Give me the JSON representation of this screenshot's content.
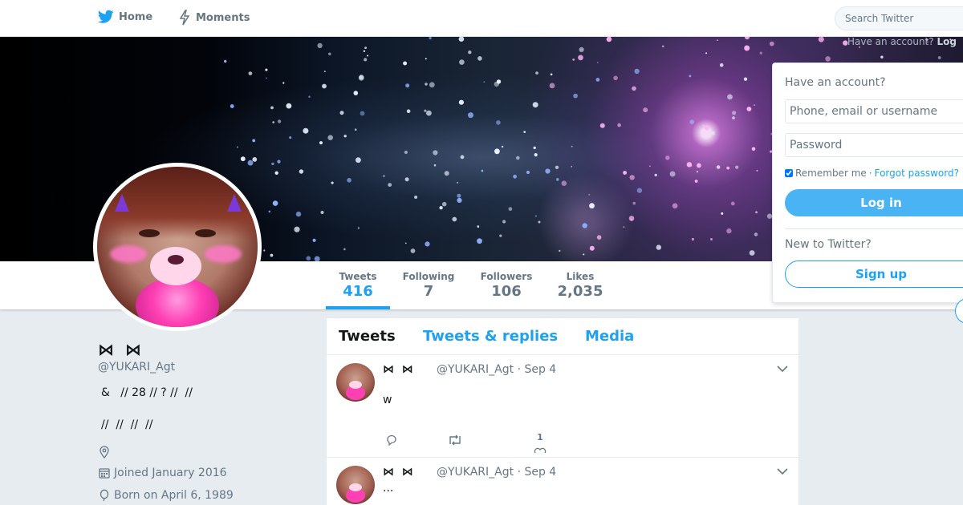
{
  "nav": {
    "home_label": "Home",
    "moments_label": "Moments",
    "search_placeholder": "Search Twitter"
  },
  "login_hint": {
    "text": "Have an account?",
    "link": "Log"
  },
  "login_card": {
    "title": "Have an account?",
    "username_placeholder": "Phone, email or username",
    "password_placeholder": "Password",
    "remember_label": "Remember me",
    "separator": "·",
    "forgot_label": "Forgot password?",
    "login_button": "Log in",
    "new_label": "New to Twitter?",
    "signup_button": "Sign up"
  },
  "stats": {
    "tweets": {
      "label": "Tweets",
      "value": "416"
    },
    "following": {
      "label": "Following",
      "value": "7"
    },
    "followers": {
      "label": "Followers",
      "value": "106"
    },
    "likes": {
      "label": "Likes",
      "value": "2,035"
    }
  },
  "profile": {
    "name": "⋈ ￼￼￼￼￼ ⋈",
    "handle": "@YUKARI_Agt",
    "bio_line1": "&   // 28 // ? //  //",
    "bio_line2": "//  //  //  //",
    "joined": "Joined January 2016",
    "born": "Born on April 6, 1989"
  },
  "timeline": {
    "tabs": [
      "Tweets",
      "Tweets & replies",
      "Media"
    ],
    "tweets": [
      {
        "name": "⋈  ⋈",
        "meta": "@YUKARI_Agt · Sep 4",
        "text": "w",
        "like_count": "1"
      },
      {
        "name": "⋈  ⋈",
        "meta": "@YUKARI_Agt · Sep 4",
        "text": "..."
      }
    ]
  },
  "colors": {
    "accent": "#1da1f2",
    "background": "#e6ecf0",
    "text_secondary": "#657786"
  }
}
